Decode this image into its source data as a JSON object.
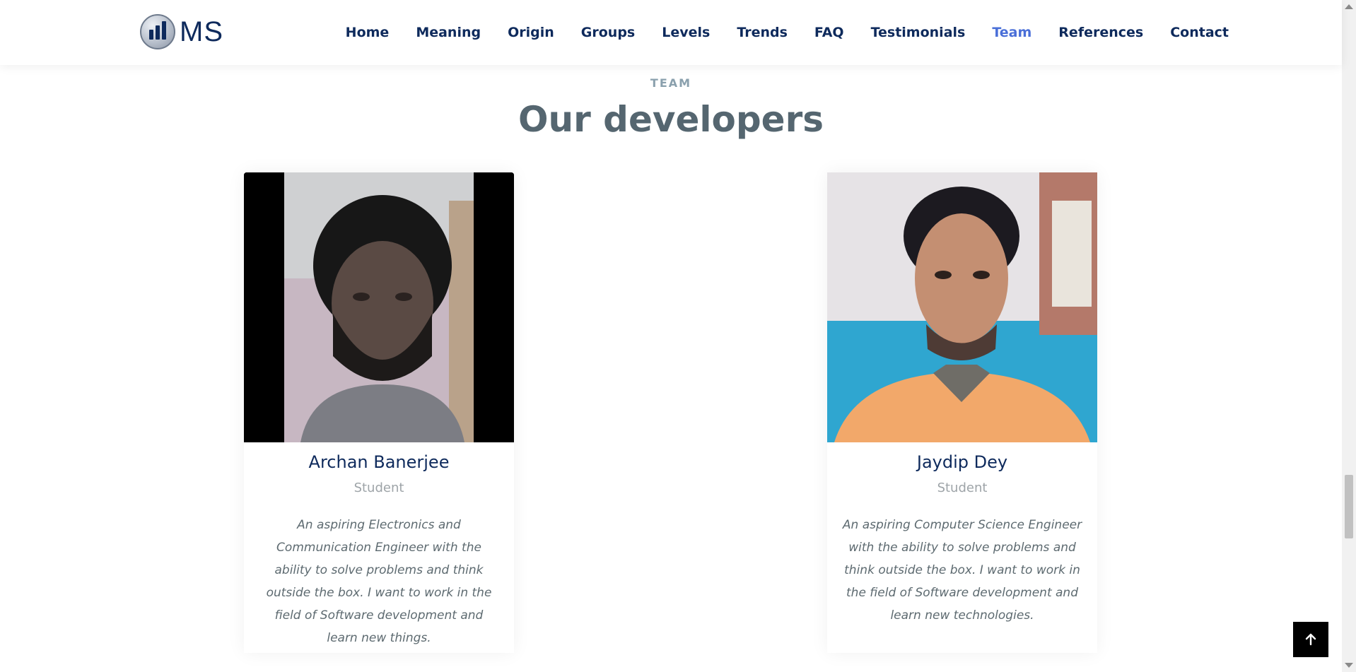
{
  "header": {
    "logo_text": "MS",
    "nav": [
      {
        "label": "Home",
        "active": false
      },
      {
        "label": "Meaning",
        "active": false
      },
      {
        "label": "Origin",
        "active": false
      },
      {
        "label": "Groups",
        "active": false
      },
      {
        "label": "Levels",
        "active": false
      },
      {
        "label": "Trends",
        "active": false
      },
      {
        "label": "FAQ",
        "active": false
      },
      {
        "label": "Testimonials",
        "active": false
      },
      {
        "label": "Team",
        "active": true
      },
      {
        "label": "References",
        "active": false
      },
      {
        "label": "Contact",
        "active": false
      }
    ]
  },
  "section": {
    "kicker": "TEAM",
    "title": "Our developers"
  },
  "members": [
    {
      "name": "Archan Banerjee",
      "role": "Student",
      "bio": "An aspiring Electronics and Communication Engineer with the ability to solve problems and think outside the box. I want to work in the field of Software development and learn new things."
    },
    {
      "name": "Jaydip Dey",
      "role": "Student",
      "bio": "An aspiring Computer Science Engineer with the ability to solve problems and think outside the box. I want to work in the field of Software development and learn new technologies."
    }
  ],
  "colors": {
    "brand": "#0e2a5c",
    "active_nav": "#4a6fd8",
    "title": "#556670"
  },
  "icons": {
    "back_to_top": "arrow-up-icon",
    "logo": "bar-chart-icon"
  }
}
